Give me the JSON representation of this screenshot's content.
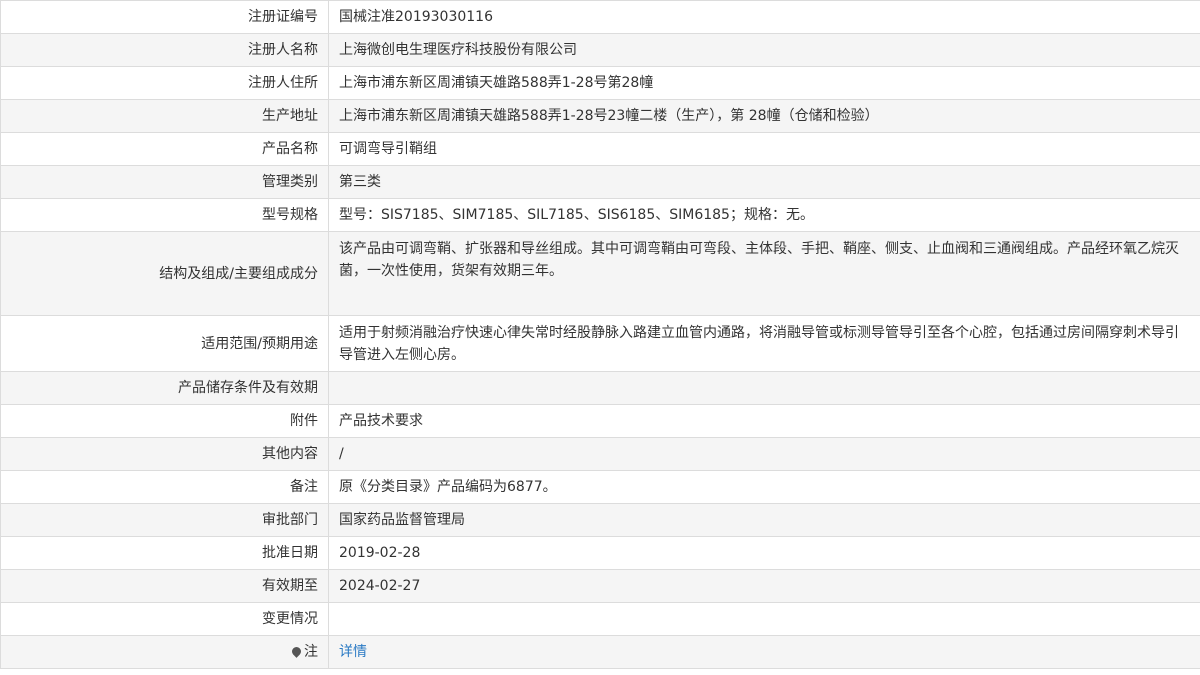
{
  "rows": [
    {
      "label": "注册证编号",
      "value": "国械注准20193030116"
    },
    {
      "label": "注册人名称",
      "value": "上海微创电生理医疗科技股份有限公司"
    },
    {
      "label": "注册人住所",
      "value": "上海市浦东新区周浦镇天雄路588弄1-28号第28幢"
    },
    {
      "label": "生产地址",
      "value": "上海市浦东新区周浦镇天雄路588弄1-28号23幢二楼（生产），第 28幢（仓储和检验）"
    },
    {
      "label": "产品名称",
      "value": "可调弯导引鞘组"
    },
    {
      "label": "管理类别",
      "value": "第三类"
    },
    {
      "label": "型号规格",
      "value": "型号：SIS7185、SIM7185、SIL7185、SIS6185、SIM6185；规格：无。"
    },
    {
      "label": "结构及组成/主要组成成分",
      "value": "该产品由可调弯鞘、扩张器和导丝组成。其中可调弯鞘由可弯段、主体段、手把、鞘座、侧支、止血阀和三通阀组成。产品经环氧乙烷灭菌，一次性使用，货架有效期三年。"
    },
    {
      "label": "适用范围/预期用途",
      "value": "适用于射频消融治疗快速心律失常时经股静脉入路建立血管内通路，将消融导管或标测导管导引至各个心腔，包括通过房间隔穿刺术导引导管进入左侧心房。"
    },
    {
      "label": "产品储存条件及有效期",
      "value": ""
    },
    {
      "label": "附件",
      "value": "产品技术要求"
    },
    {
      "label": "其他内容",
      "value": "/"
    },
    {
      "label": "备注",
      "value": "原《分类目录》产品编码为6877。"
    },
    {
      "label": "审批部门",
      "value": "国家药品监督管理局"
    },
    {
      "label": "批准日期",
      "value": "2019-02-28"
    },
    {
      "label": "有效期至",
      "value": "2024-02-27"
    },
    {
      "label": "变更情况",
      "value": ""
    },
    {
      "label": "注",
      "value": "详情"
    }
  ],
  "icons": {
    "note_icon": "map-pin-icon"
  },
  "colors": {
    "border": "#dcdcdc",
    "row_alt_bg": "#f5f5f5",
    "text": "#333333",
    "link": "#2a7ac4"
  }
}
